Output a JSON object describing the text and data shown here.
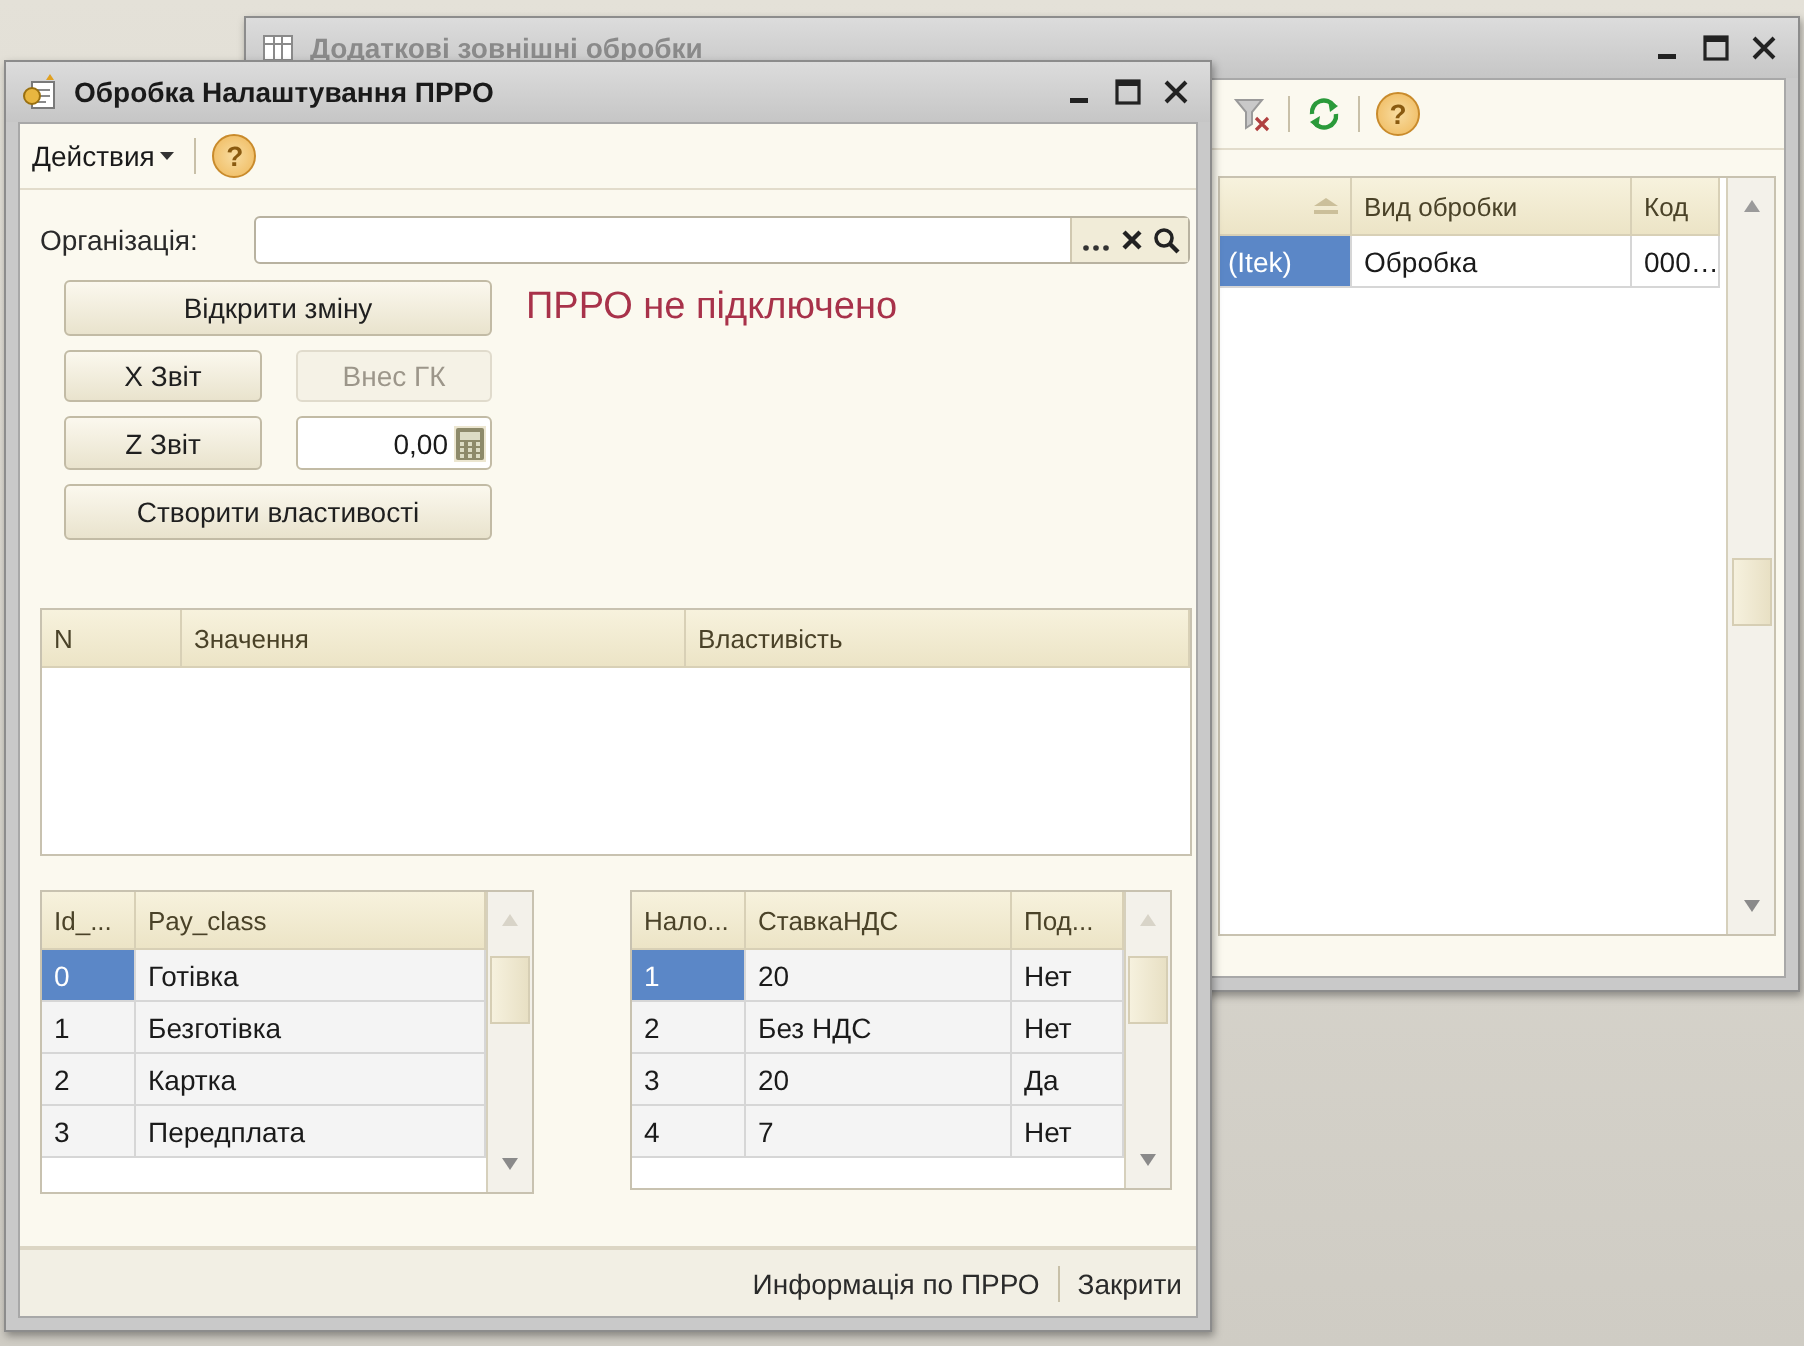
{
  "background_window": {
    "title": "Додаткові зовнішні обробки",
    "toolbar": {
      "help": "?"
    },
    "table": {
      "columns": [
        {
          "sorted": true
        },
        {
          "label": "Вид обробки",
          "sorted": false
        },
        {
          "label": "Код",
          "sorted": false
        }
      ],
      "rows": [
        {
          "cells": [
            {
              "text": "(Itek)",
              "selected": true
            },
            {
              "text": "Обробка",
              "selected": false
            },
            {
              "text": "000…",
              "selected": false
            }
          ]
        }
      ]
    }
  },
  "window": {
    "title": "Обробка Налаштування ПРРО",
    "menu": {
      "label": "Действия",
      "help": "?"
    },
    "organization": {
      "label": "Організація:"
    },
    "buttons": [
      {
        "label": "Відкрити зміну",
        "disabled": false
      },
      {
        "label": "X Звіт",
        "disabled": false
      },
      {
        "label": "Внес ГК",
        "disabled": true
      },
      {
        "label": "Z Звіт",
        "disabled": false
      },
      {
        "label": "Створити властивості",
        "disabled": false
      }
    ],
    "status": "ПРРО не підключено",
    "amount": "0,00",
    "properties_table": {
      "columns": [
        {
          "label": "N"
        },
        {
          "label": "Значення"
        },
        {
          "label": "Властивість"
        }
      ]
    },
    "pay_table": {
      "columns": [
        {
          "label": "Id_..."
        },
        {
          "label": "Pay_class"
        }
      ],
      "rows": [
        {
          "cells": [
            {
              "text": "0",
              "selected": true
            },
            {
              "text": "Готівка",
              "selected": false
            }
          ]
        },
        {
          "cells": [
            {
              "text": "1",
              "selected": false
            },
            {
              "text": "Безготівка",
              "selected": false
            }
          ]
        },
        {
          "cells": [
            {
              "text": "2",
              "selected": false
            },
            {
              "text": "Картка",
              "selected": false
            }
          ]
        },
        {
          "cells": [
            {
              "text": "3",
              "selected": false
            },
            {
              "text": "Передплата",
              "selected": false
            }
          ]
        }
      ]
    },
    "tax_table": {
      "columns": [
        {
          "label": "Нало..."
        },
        {
          "label": "СтавкаНДС"
        },
        {
          "label": "Под..."
        }
      ],
      "rows": [
        {
          "cells": [
            {
              "text": "1",
              "selected": true
            },
            {
              "text": "20",
              "selected": false
            },
            {
              "text": "Нет",
              "selected": false
            }
          ]
        },
        {
          "cells": [
            {
              "text": "2",
              "selected": false
            },
            {
              "text": "Без НДС",
              "selected": false
            },
            {
              "text": "Нет",
              "selected": false
            }
          ]
        },
        {
          "cells": [
            {
              "text": "3",
              "selected": false
            },
            {
              "text": "20",
              "selected": false
            },
            {
              "text": "Да",
              "selected": false
            }
          ]
        },
        {
          "cells": [
            {
              "text": "4",
              "selected": false
            },
            {
              "text": "7",
              "selected": false
            },
            {
              "text": "Нет",
              "selected": false
            }
          ]
        }
      ]
    },
    "footer_buttons": [
      "Информація по ПРРО",
      "Закрити"
    ]
  }
}
